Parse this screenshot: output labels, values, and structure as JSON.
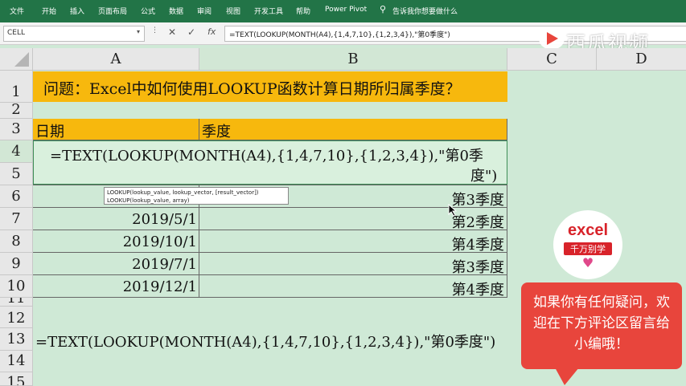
{
  "ribbon": {
    "tabs": [
      "文件",
      "开始",
      "插入",
      "页面布局",
      "公式",
      "数据",
      "审阅",
      "视图",
      "开发工具",
      "帮助",
      "Power Pivot"
    ],
    "search_hint": "告诉我你想要做什么",
    "bg": "#227447"
  },
  "formula_bar": {
    "name_box": "CELL",
    "cancel_icon": "cross-icon",
    "enter_icon": "check-icon",
    "fx_label": "fx",
    "formula": "=TEXT(LOOKUP(MONTH(A4),{1,4,7,10},{1,2,3,4}),\"第0季度\")"
  },
  "columns": [
    "A",
    "B",
    "C",
    "D"
  ],
  "rows": [
    "1",
    "2",
    "3",
    "4",
    "5",
    "6",
    "7",
    "8",
    "9",
    "10",
    "11",
    "12",
    "13",
    "14",
    "15"
  ],
  "sheet": {
    "title": "问题：Excel中如何使用LOOKUP函数计算日期所归属季度？",
    "header_a": "日期",
    "header_b": "季度",
    "editing_formula_line1": "=TEXT(LOOKUP(MONTH(A4),{1,4,7,10},{1,2,3,4}),\"第0季",
    "editing_formula_line2": "度\")",
    "data": [
      {
        "date": "",
        "quarter": "第3季度"
      },
      {
        "date": "2019/5/1",
        "quarter": "第2季度"
      },
      {
        "date": "2019/10/1",
        "quarter": "第4季度"
      },
      {
        "date": "2019/7/1",
        "quarter": "第3季度"
      },
      {
        "date": "2019/12/1",
        "quarter": "第4季度"
      }
    ],
    "row13_formula": "=TEXT(LOOKUP(MONTH(A4),{1,4,7,10},{1,2,3,4}),\"第0季度\")"
  },
  "tooltip": {
    "line1": "LOOKUP(lookup_value, lookup_vector, [result_vector])",
    "line2": "LOOKUP(lookup_value, array)"
  },
  "overlay": {
    "watermark": "西瓜视频",
    "badge_top": "excel",
    "badge_bottom": "千万别学",
    "bubble_text": "如果你有任何疑问，欢迎在下方评论区留言给小编哦！",
    "bubble_color": "#e8453c",
    "highlight_color": "#f7b80d"
  }
}
